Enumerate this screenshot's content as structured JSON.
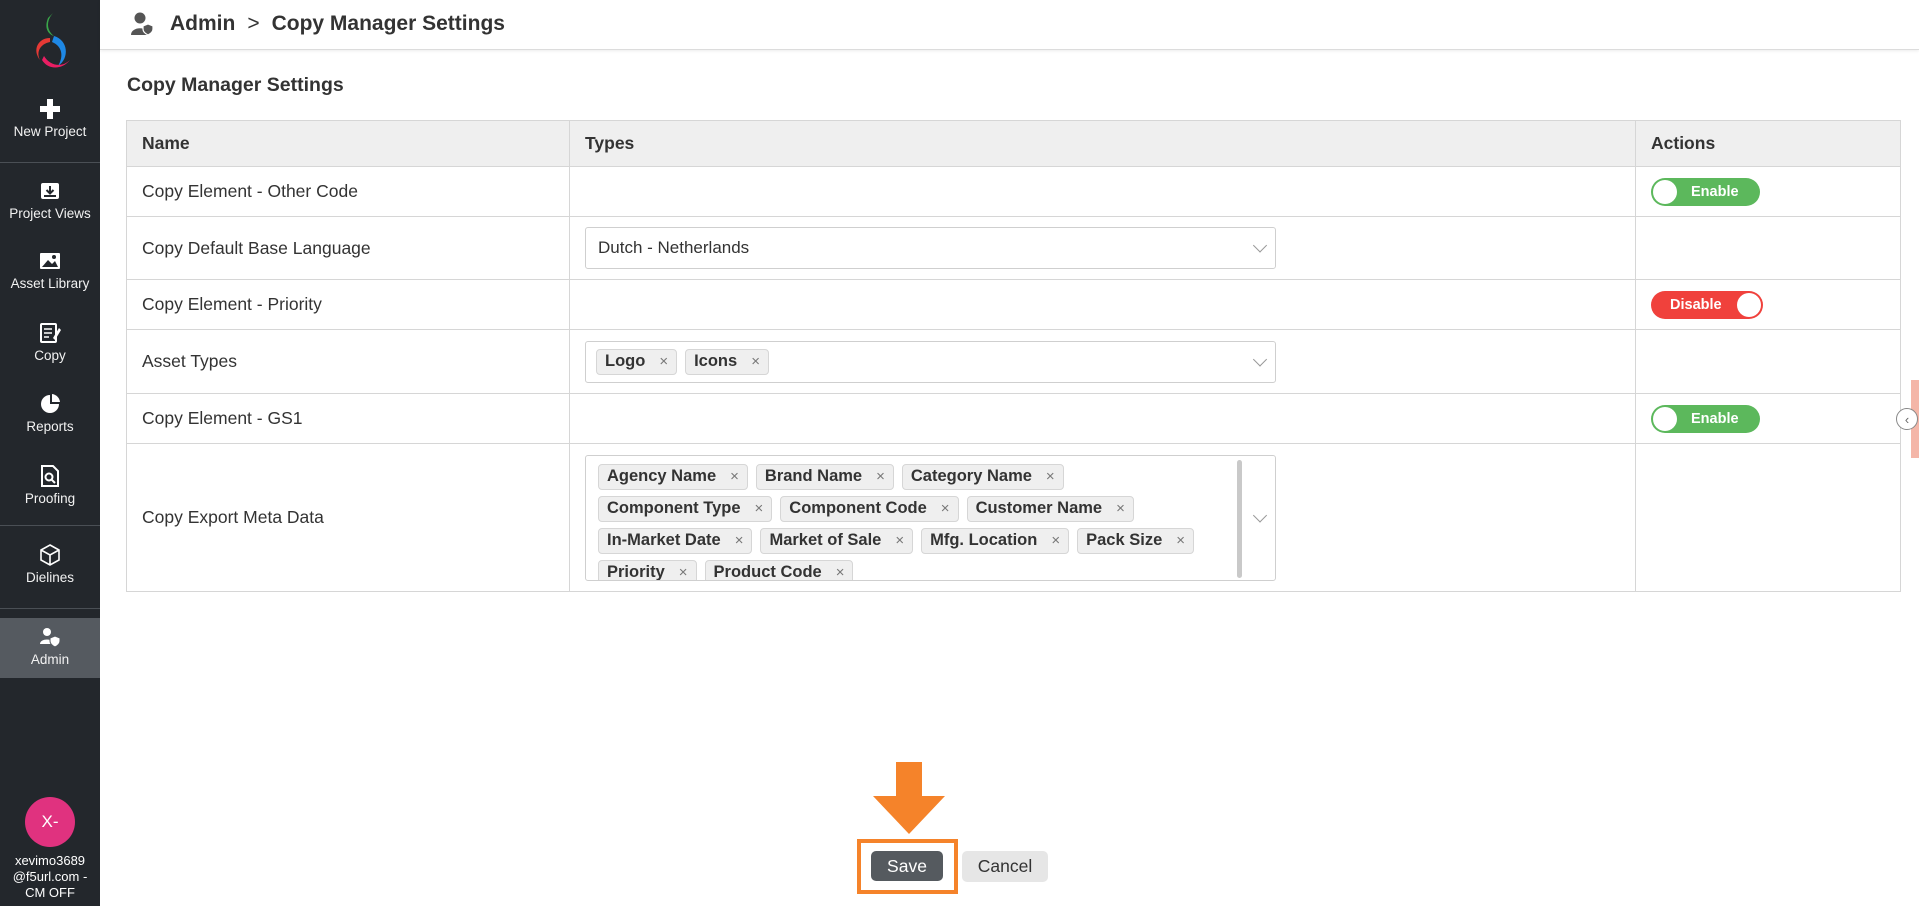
{
  "sidebar": {
    "items": [
      {
        "label": "New Project",
        "icon": "plus-icon"
      },
      {
        "label": "Project Views",
        "icon": "inbox-download-icon"
      },
      {
        "label": "Asset Library",
        "icon": "image-icon"
      },
      {
        "label": "Copy",
        "icon": "edit-document-icon"
      },
      {
        "label": "Reports",
        "icon": "pie-chart-icon"
      },
      {
        "label": "Proofing",
        "icon": "document-search-icon"
      },
      {
        "label": "Dielines",
        "icon": "cube-icon"
      },
      {
        "label": "Admin",
        "icon": "user-shield-icon"
      }
    ],
    "avatar_initials": "X-",
    "user_line1": "xevimo3689",
    "user_line2": "@f5url.com -",
    "user_line3": "CM OFF"
  },
  "header": {
    "crumb_root": "Admin",
    "separator": ">",
    "crumb_current": "Copy Manager Settings"
  },
  "page": {
    "title": "Copy Manager Settings"
  },
  "table": {
    "headers": {
      "name": "Name",
      "types": "Types",
      "actions": "Actions"
    },
    "rows": [
      {
        "name": "Copy Element - Other Code",
        "toggle": "Enable"
      },
      {
        "name": "Copy Default Base Language",
        "select_value": "Dutch - Netherlands"
      },
      {
        "name": "Copy Element - Priority",
        "toggle": "Disable"
      },
      {
        "name": "Asset Types",
        "tags": [
          "Logo",
          "Icons"
        ]
      },
      {
        "name": "Copy Element - GS1",
        "toggle": "Enable"
      },
      {
        "name": "Copy Export Meta Data",
        "tags": [
          "Agency Name",
          "Brand Name",
          "Category Name",
          "Component Type",
          "Component Code",
          "Customer Name",
          "In-Market Date",
          "Market of Sale",
          "Mfg. Location",
          "Pack Size",
          "Priority",
          "Product Code"
        ]
      }
    ],
    "tag_remove_glyph": "×"
  },
  "actions": {
    "save_label": "Save",
    "cancel_label": "Cancel"
  },
  "colors": {
    "sidebar_bg": "#23272c",
    "enable_green": "#5cb85c",
    "disable_red": "#f0413c",
    "highlight_orange": "#f5832a",
    "avatar_pink": "#e0327f"
  }
}
